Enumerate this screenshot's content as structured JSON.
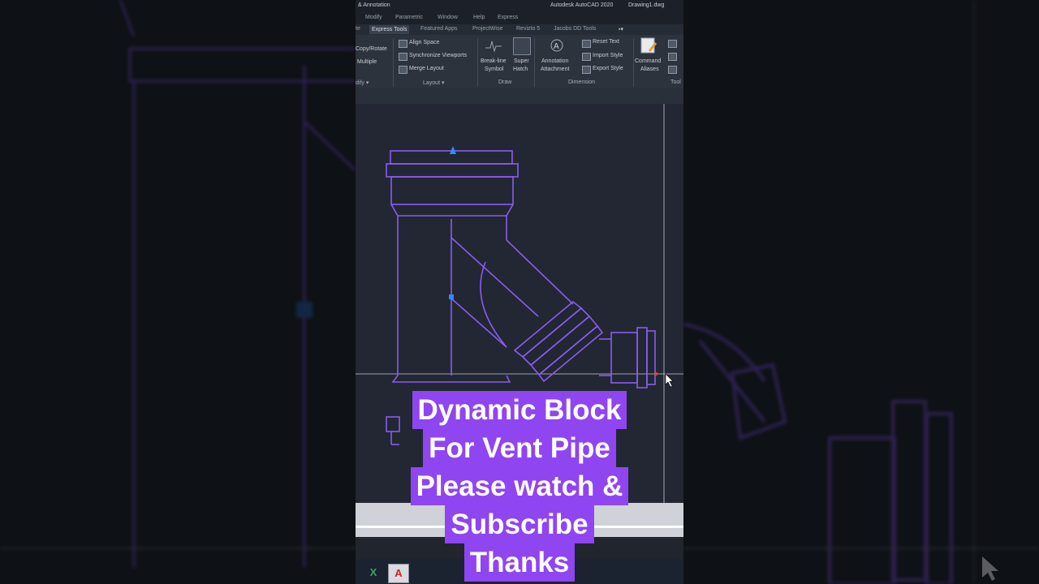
{
  "titlebar": {
    "workspace": "& Annotation",
    "app_title": "Autodesk AutoCAD 2020",
    "doc_title": "Drawing1.dwg"
  },
  "menu": [
    "Modify",
    "Parametric",
    "Window",
    "Help",
    "Express"
  ],
  "tabs": [
    "te",
    "Express Tools",
    "Featured Apps",
    "ProjectWise",
    "Revizto 5",
    "Jacobs DD Tools"
  ],
  "active_tab": "Express Tools",
  "ribbon": {
    "modify_items": [
      "Copy/Rotate",
      "Multiple"
    ],
    "modify_label": "dify",
    "layout_items": [
      "Align Space",
      "Synchronize Viewports",
      "Merge Layout"
    ],
    "layout_label": "Layout",
    "draw_items": [
      {
        "line1": "Break-line",
        "line2": "Symbol",
        "icon": "break-line-icon"
      },
      {
        "line1": "Super",
        "line2": "Hatch",
        "icon": "super-hatch-icon"
      }
    ],
    "draw_label": "Draw",
    "dimension_annotation": {
      "line1": "Annotation",
      "line2": "Attachment"
    },
    "dimension_items": [
      "Reset Text",
      "Import Style",
      "Export Style"
    ],
    "dimension_label": "Dimension",
    "tools_command": {
      "line1": "Command",
      "line2": "Aliases"
    },
    "tools_label": "Tool"
  },
  "caption": {
    "line1": "Dynamic Block",
    "line2": "For Vent Pipe",
    "line3": "Please watch &",
    "line4": "Subscribe",
    "line5": "Thanks"
  },
  "colors": {
    "caption_bg": "#8f45f0",
    "pipe_stroke": "#8a5cf0",
    "canvas_bg": "#222733",
    "grip": "#2d8cff"
  },
  "taskbar_icons": [
    "excel-icon",
    "autocad-icon"
  ]
}
